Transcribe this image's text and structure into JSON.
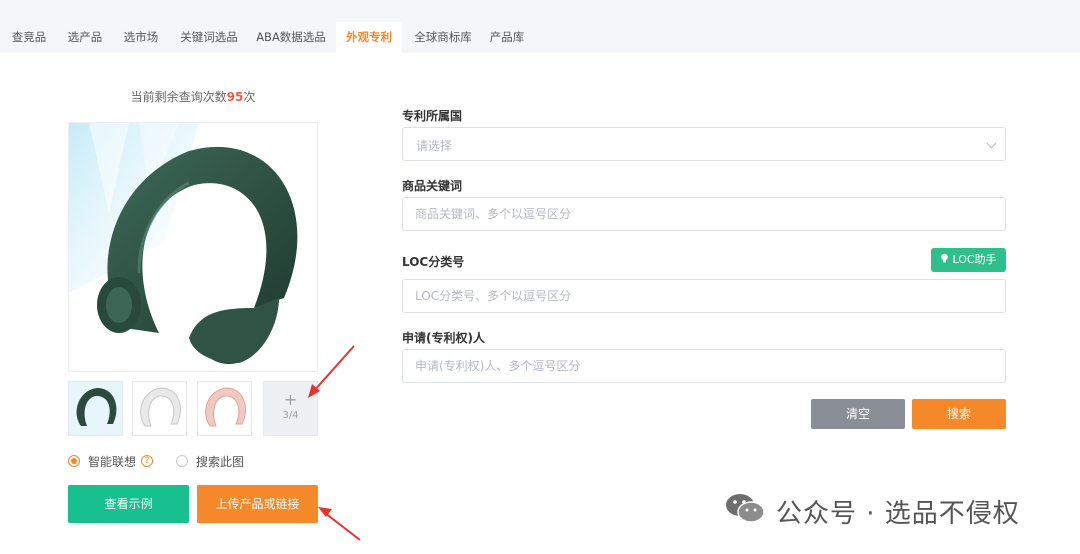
{
  "tabs": [
    {
      "label": "查竞品",
      "active": false
    },
    {
      "label": "选产品",
      "active": false
    },
    {
      "label": "选市场",
      "active": false
    },
    {
      "label": "关键词选品",
      "active": false
    },
    {
      "label": "ABA数据选品",
      "active": false
    },
    {
      "label": "外观专利",
      "active": true
    },
    {
      "label": "全球商标库",
      "active": false
    },
    {
      "label": "产品库",
      "active": false
    }
  ],
  "left": {
    "quota_prefix": "当前剩余查询次数",
    "quota_count": "95",
    "quota_suffix": "次",
    "thumb_plus": "+",
    "thumb_count": "3/4",
    "radio_smart": "智能联想",
    "help_mark": "?",
    "radio_search_image": "搜索此图",
    "btn_example": "查看示例",
    "btn_upload": "上传产品或链接"
  },
  "form": {
    "country_label": "专利所属国",
    "country_placeholder": "请选择",
    "keyword_label": "商品关键词",
    "keyword_placeholder": "商品关键词、多个以逗号区分",
    "loc_label": "LOC分类号",
    "loc_helper_btn": "LOC助手",
    "loc_placeholder": "LOC分类号、多个以逗号区分",
    "applicant_label": "申请(专利权)人",
    "applicant_placeholder": "申请(专利权)人、多个逗号区分",
    "clear_btn": "清空",
    "search_btn": "搜索"
  },
  "watermark": {
    "text": "公众号 · 选品不侵权"
  },
  "colors": {
    "accent_orange": "#f5892a",
    "accent_green": "#18c08f",
    "arrow_red": "#e8322d",
    "product_green": "#2c4a3e"
  },
  "icons": {
    "loc_helper": "lightbulb-icon",
    "select": "chevron-down-icon",
    "watermark": "wechat-icon"
  }
}
